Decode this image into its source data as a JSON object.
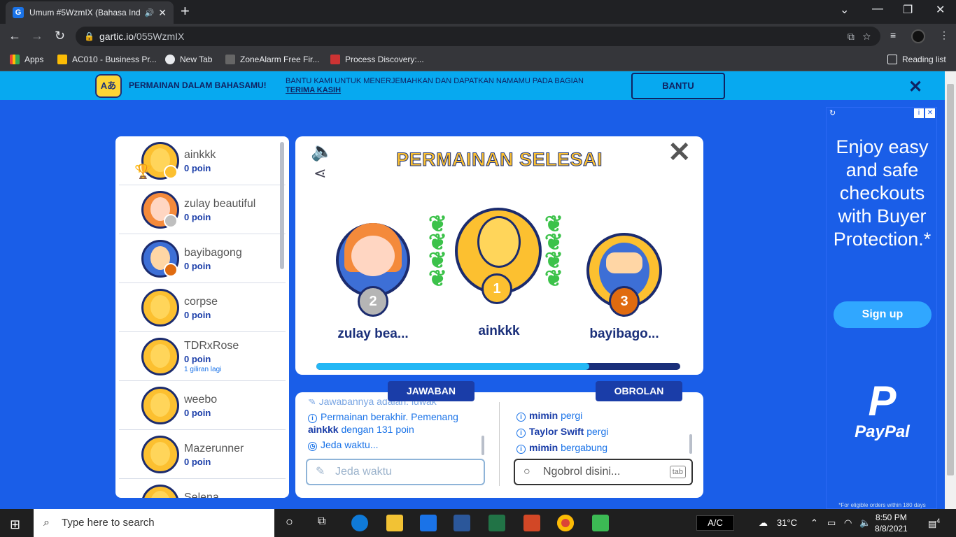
{
  "browser": {
    "tab_title": "Umum #5WzmIX (Bahasa Ind",
    "url_host": "gartic.io",
    "url_path": "/055WzmIX",
    "bookmarks": [
      "Apps",
      "AC010 - Business Pr...",
      "New Tab",
      "ZoneAlarm Free Fir...",
      "Process Discovery:..."
    ],
    "reading_list": "Reading list"
  },
  "banner": {
    "heading": "PERMAINAN DALAM BAHASAMU!",
    "text_line1": "BANTU KAMI UNTUK MENERJEMAHKAN DAN DAPATKAN NAMAMU PADA BAGIAN",
    "text_line2": "TERIMA KASIH",
    "button": "BANTU"
  },
  "players": [
    {
      "name": "ainkkk",
      "points": "0 poin",
      "sub": ""
    },
    {
      "name": "zulay beautiful",
      "points": "0 poin",
      "sub": ""
    },
    {
      "name": "bayibagong",
      "points": "0 poin",
      "sub": ""
    },
    {
      "name": "corpse",
      "points": "0 poin",
      "sub": ""
    },
    {
      "name": "TDRxRose",
      "points": "0 poin",
      "sub": "1 giliran lagi"
    },
    {
      "name": "weebo",
      "points": "0 poin",
      "sub": ""
    },
    {
      "name": "Mazerunner",
      "points": "0 poin",
      "sub": ""
    },
    {
      "name": "Selena",
      "points": "",
      "sub": ""
    }
  ],
  "result": {
    "title": "PERMAINAN SELESAI",
    "first": {
      "name": "ainkkk",
      "rank": "1"
    },
    "second": {
      "name": "zulay bea...",
      "rank": "2"
    },
    "third": {
      "name": "bayibago...",
      "rank": "3"
    },
    "progress": 0.75
  },
  "answers": {
    "tab": "JAWABAN",
    "line0": "Jawabannya adalah: luwak",
    "line1a": "Permainan berakhir. Pemenang",
    "line1_winner": "ainkkk",
    "line1b": "dengan 131 poin",
    "line2": "Jeda waktu...",
    "placeholder": "Jeda waktu"
  },
  "chat": {
    "tab": "OBROLAN",
    "msgs": [
      {
        "user": "mimin",
        "action": "pergi"
      },
      {
        "user": "Taylor Swift",
        "action": "pergi"
      },
      {
        "user": "mimin",
        "action": "bergabung"
      }
    ],
    "placeholder": "Ngobrol disini...",
    "key": "tab"
  },
  "ad": {
    "text": "Enjoy easy and safe checkouts with Buyer Protection.*",
    "button": "Sign up",
    "brand": "PayPal",
    "fine": "*For eligible orders within 180 days"
  },
  "taskbar": {
    "search": "Type here to search",
    "ac": "A/C",
    "weather": "31°C",
    "time": "8:50 PM",
    "date": "8/8/2021",
    "notif": "4"
  }
}
